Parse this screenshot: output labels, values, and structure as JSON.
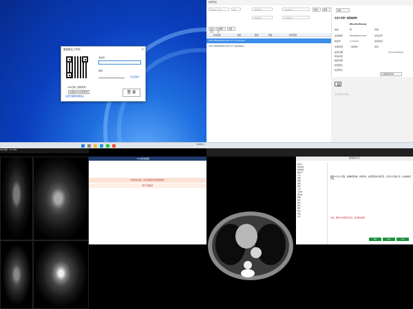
{
  "login": {
    "title": "患者医生工作站",
    "close": "✕",
    "phone_label": "手机号:",
    "password_label": "密码:",
    "forgot": "忘记密码?",
    "qr_caption": "APP扫码二维码登录",
    "qr_subcaption": "请使用APP扫码登录",
    "app_link": "设置代理服务器地址",
    "login_button": "登 录"
  },
  "taskbar": {
    "time": "2023/1/1"
  },
  "app": {
    "title": "检查列表",
    "search_placeholder": "检查编号、姓名",
    "filter1": "检查",
    "filter2": "--检查项目--",
    "filter3": "--检查类型--",
    "filter4": "--登记时间--",
    "filter5": "--全部检查--",
    "btn_query": "查询",
    "btn_refresh": "刷新",
    "btn_new": "新增",
    "btn_register": "患者登记",
    "btn_new_dept": "新增检查",
    "btn_dept2": "新增",
    "table_headers": [
      "检查编号",
      "姓名",
      "性别",
      "年龄",
      "检查项目"
    ],
    "rows": [
      {
        "text": "2013   PE2000001X591   CT   Thorax/Abd"
      },
      {
        "text": "2013   PE2000001X591   CT   Head/Brain"
      }
    ],
    "side_title": "北京大学第一医院放射科",
    "side_name": "ZhaoPeiSheng",
    "labels": [
      "姓名",
      "患者编号",
      "检查号",
      "患者来源",
      "检查日期",
      "申请科室",
      "临床诊断",
      "检查部位",
      "检查所见",
      "检查机房",
      "打印标识"
    ],
    "values": [
      "男",
      "PE2000001X591",
      "1715222",
      "--请选择--",
      "",
      "",
      "",
      "",
      "",
      "",
      ""
    ],
    "right_labels": [
      "年龄",
      "身份证号",
      "检查项目",
      "机房",
      "ThoraxAbdGen"
    ],
    "print_btn": "打印检查申请单",
    "note_placeholder": "请在此输入备注..."
  },
  "viewer": {
    "title": "MRI影像 - 3D MPR",
    "report_title": "RIS 报告编辑器",
    "alert1": "检查尚未完成，请先完成检查后再编辑报告",
    "alert2": "报告已被锁定"
  },
  "report": {
    "title": "检查报告书写",
    "sidebar_items": [
      "检查号",
      "检查所见",
      "影像诊断",
      "胸部CT",
      "平扫",
      "增强",
      "纵隔",
      "肺窗",
      "骨窗",
      "心影",
      "主动脉",
      "淋巴结",
      "胸膜",
      "结论",
      "建议",
      "随访",
      "附件",
      "签名",
      "审核",
      "打印"
    ],
    "finding": "胸部CT平扫+增强：双肺纹理清晰，纵隔居中，未见明显肿大淋巴结，心影大小形态正常，主动脉未见异常。",
    "conclusion": "印象：胸部CT未见明显异常。建议随访观察。",
    "btn_save": "保存",
    "btn_submit": "提交",
    "btn_print": "打印"
  }
}
